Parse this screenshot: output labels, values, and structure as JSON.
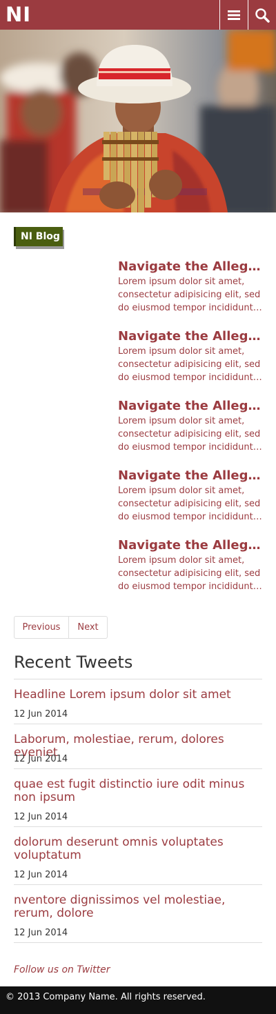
{
  "header": {
    "logo": "NI",
    "brand_color": "#9b3b40",
    "menu_icon": "menu-icon",
    "search_icon": "search-icon"
  },
  "hero": {
    "image": "pan-flute-player-photo"
  },
  "blog": {
    "badge_label": "NI Blog",
    "badge_color": "#4a5e10",
    "posts": [
      {
        "title": "Navigate the Allegheny River",
        "excerpt": "Lorem ipsum dolor sit amet, consectetur adipisicing elit, sed do eiusmod tempor incididunt ut labore"
      },
      {
        "title": "Navigate the Allegheny River",
        "excerpt": "Lorem ipsum dolor sit amet, consectetur adipisicing elit, sed do eiusmod tempor incididunt ut labore"
      },
      {
        "title": "Navigate the Allegheny River",
        "excerpt": "Lorem ipsum dolor sit amet, consectetur adipisicing elit, sed do eiusmod tempor incididunt ut labore"
      },
      {
        "title": "Navigate the Allegheny River",
        "excerpt": "Lorem ipsum dolor sit amet, consectetur adipisicing elit, sed do eiusmod tempor incididunt ut labore"
      },
      {
        "title": "Navigate the Allegheny River",
        "excerpt": "Lorem ipsum dolor sit amet, consectetur adipisicing elit, sed do eiusmod tempor incididunt ut labore"
      }
    ]
  },
  "pager": {
    "previous_label": "Previous",
    "next_label": "Next"
  },
  "tweets": {
    "heading": "Recent Tweets",
    "items": [
      {
        "text": "Headline Lorem ipsum dolor sit amet",
        "date": "12 Jun 2014"
      },
      {
        "text": "Laborum, molestiae, rerum, dolores eveniet",
        "date": "12 Jun 2014"
      },
      {
        "text": "quae est fugit distinctio iure odit minus non ipsum",
        "date": "12 Jun 2014"
      },
      {
        "text": "dolorum deserunt omnis voluptates voluptatum",
        "date": "12 Jun 2014"
      },
      {
        "text": "nventore dignissimos vel molestiae, rerum, dolore",
        "date": "12 Jun 2014"
      }
    ],
    "follow_label": "Follow us on Twitter"
  },
  "footer": {
    "copyright": "© 2013 Company Name. All rights reserved."
  }
}
